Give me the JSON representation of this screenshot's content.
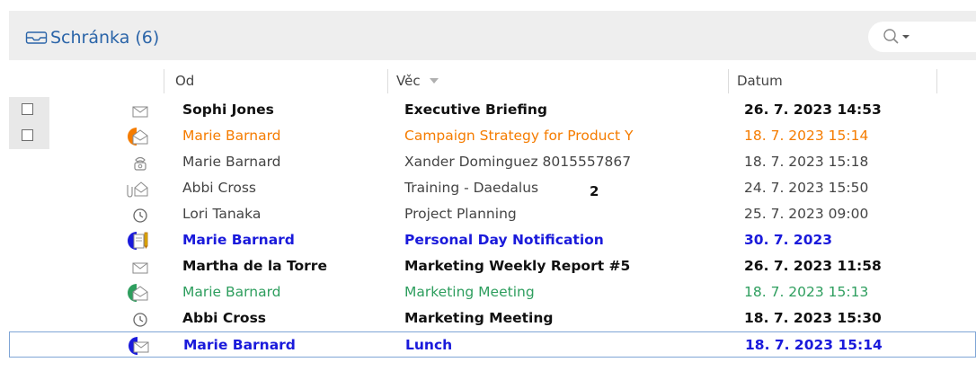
{
  "header": {
    "title": "Schránka (6)",
    "search_icon": "search-icon"
  },
  "columns": {
    "from": "Od",
    "subject": "Věc",
    "date": "Datum"
  },
  "badge": "2",
  "colors": {
    "orange": "#f57c00",
    "blue": "#1a1adb",
    "green": "#2e9e5e",
    "header_blue": "#2a64a8"
  },
  "rows": [
    {
      "from": "Sophi Jones",
      "subject": "Executive Briefing",
      "date": "26. 7. 2023 14:53",
      "icon": "envelope-icon",
      "style": "bold",
      "color": "#111111"
    },
    {
      "from": "Marie Barnard",
      "subject": "Campaign Strategy for Product Y",
      "date": "18. 7. 2023 15:14",
      "icon": "open-envelope-icon",
      "style": "normal",
      "color": "#f57c00"
    },
    {
      "from": "Marie Barnard",
      "subject": "Xander Dominguez 8015557867",
      "date": "18. 7. 2023 15:18",
      "icon": "phone-icon",
      "style": "normal",
      "color": "#444444"
    },
    {
      "from": "Abbi Cross",
      "subject": "Training - Daedalus",
      "date": "24. 7. 2023 15:50",
      "icon": "attachment-envelope-icon",
      "style": "normal",
      "color": "#444444"
    },
    {
      "from": "Lori Tanaka",
      "subject": "Project Planning",
      "date": "25. 7. 2023 09:00",
      "icon": "clock-icon",
      "style": "normal",
      "color": "#444444"
    },
    {
      "from": "Marie Barnard",
      "subject": "Personal Day Notification",
      "date": "30. 7. 2023",
      "icon": "note-icon",
      "style": "bold",
      "color": "#1a1adb"
    },
    {
      "from": "Martha de la Torre",
      "subject": "Marketing Weekly Report #5",
      "date": "26. 7. 2023 11:58",
      "icon": "envelope-icon",
      "style": "bold",
      "color": "#111111"
    },
    {
      "from": "Marie Barnard",
      "subject": "Marketing Meeting",
      "date": "18. 7. 2023 15:13",
      "icon": "open-envelope-icon",
      "style": "normal",
      "color": "#2e9e5e"
    },
    {
      "from": "Abbi Cross",
      "subject": "Marketing Meeting",
      "date": "18. 7. 2023 15:30",
      "icon": "clock-icon",
      "style": "bold",
      "color": "#111111"
    },
    {
      "from": "Marie Barnard",
      "subject": "Lunch",
      "date": "18. 7. 2023 15:14",
      "icon": "envelope-icon",
      "style": "bold",
      "color": "#1a1adb"
    }
  ]
}
